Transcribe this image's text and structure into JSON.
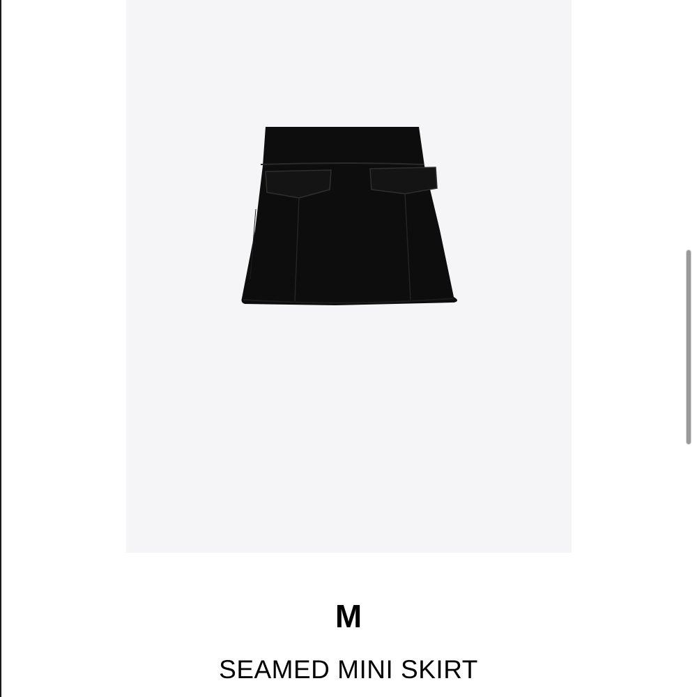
{
  "product": {
    "image_icon": "skirt-photo",
    "image_background": "#f5f5f7",
    "item_color": "#0d0d0d",
    "size": "M",
    "title": "SEAMED MINI SKIRT"
  },
  "colors": {
    "page_background": "#ffffff",
    "text": "#000000",
    "scrollbar": "#9a9a9a"
  }
}
